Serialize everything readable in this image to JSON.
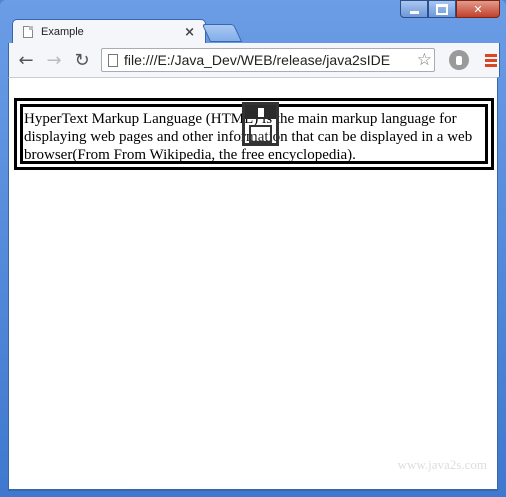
{
  "window": {
    "tab_title": "Example",
    "tab_close": "×"
  },
  "toolbar": {
    "back": "←",
    "forward": "→",
    "reload": "↻",
    "url": "file:///E:/Java_Dev/WEB/release/java2sIDE",
    "star": "☆"
  },
  "page": {
    "paragraph": "HyperText Markup Language (HTML) is the main markup language for displaying web pages and other information that can be displayed in a web browser(From From Wikipedia, the free encyclopedia).",
    "watermark": "www.java2s.com"
  }
}
